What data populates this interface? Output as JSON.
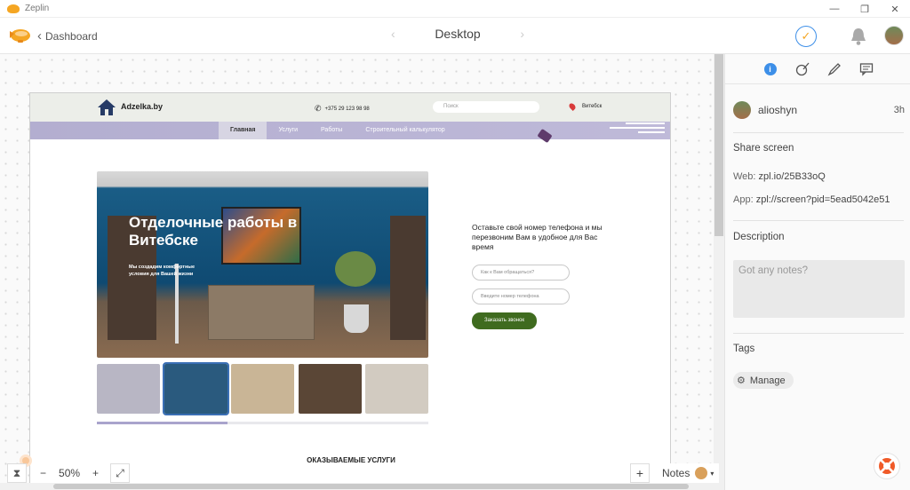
{
  "window": {
    "title": "Zeplin",
    "min": "—",
    "restore": "❐",
    "close": "✕"
  },
  "toolbar": {
    "back_label": "Dashboard",
    "screen_name": "Desktop",
    "prev": "‹",
    "next": "›"
  },
  "artboard": {
    "brand": "Adzelka.by",
    "phone": "+375 29 123 98 98",
    "search_placeholder": "Поиск",
    "city": "Витебск",
    "nav": [
      "Главная",
      "Услуги",
      "Работы",
      "Строительный калькулятор"
    ],
    "hero_title": "Отделочные работы в Витебске",
    "hero_sub": "Мы создадим комфортные условия для Вашей жизни",
    "cta_text": "Оставьте свой номер телефона и мы перезвоним Вам в удобное для Вас время",
    "name_placeholder": "Как к Вам обращаться?",
    "phone_placeholder": "Введите номер телефона",
    "button_label": "Заказать звонок",
    "services_heading": "ОКАЗЫВАЕМЫЕ УСЛУГИ",
    "thumb_colors": [
      "#b8b6c4",
      "#2a5a7e",
      "#c9b596",
      "#5a4636",
      "#d2cbc1"
    ]
  },
  "bottom": {
    "zoom_minus": "−",
    "zoom_level": "50%",
    "zoom_plus": "+",
    "plus": "+",
    "notes_label": "Notes",
    "hourglass": "⧗",
    "fit": "⤢"
  },
  "sidebar": {
    "user_name": "alioshyn",
    "user_time": "3h",
    "share_heading": "Share screen",
    "web_label": "Web:",
    "web_value": "zpl.io/25B33oQ",
    "app_label": "App:",
    "app_value": "zpl://screen?pid=5ead5042e51",
    "description_heading": "Description",
    "notes_placeholder": "Got any notes?",
    "tags_heading": "Tags",
    "manage_label": "Manage"
  },
  "colors": {
    "accent": "#3d8fe8",
    "brand": "#f5a623",
    "cta_green": "#3f6b1f",
    "nav_lilac": "#b3aed0"
  }
}
